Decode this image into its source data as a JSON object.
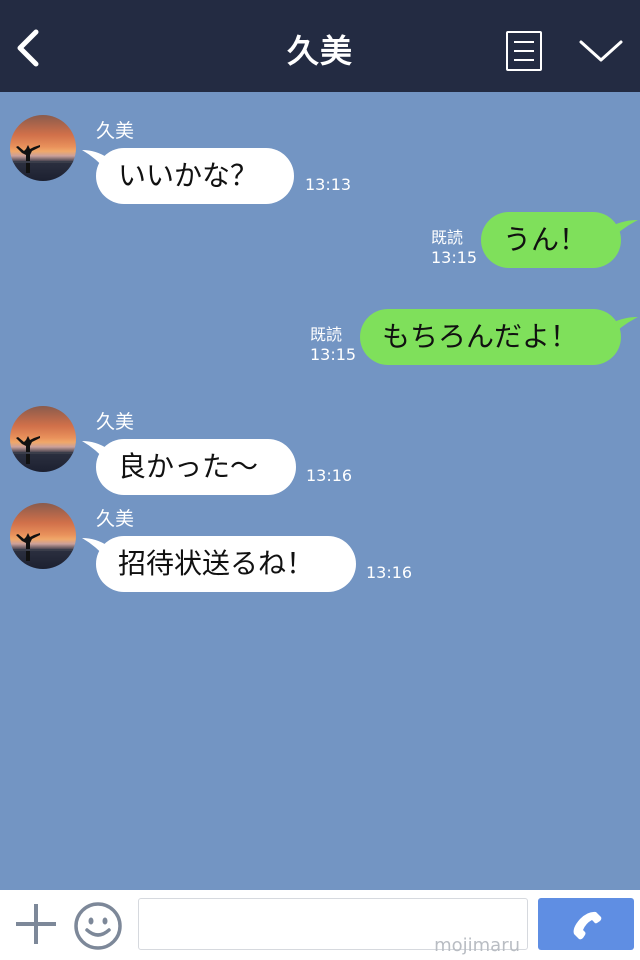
{
  "header": {
    "title": "久美",
    "back_icon": "chevron-left-icon",
    "menu_icon": "menu-icon",
    "collapse_icon": "chevron-down-icon"
  },
  "messages": [
    {
      "direction": "incoming",
      "sender": "久美",
      "text": "いいかな？",
      "time": "13:13"
    },
    {
      "direction": "outgoing",
      "read": "既読",
      "text": "うん！",
      "time": "13:15"
    },
    {
      "direction": "outgoing",
      "read": "既読",
      "text": "もちろんだよ！",
      "time": "13:15"
    },
    {
      "direction": "incoming",
      "sender": "久美",
      "text": "良かった〜",
      "time": "13:16"
    },
    {
      "direction": "incoming",
      "sender": "久美",
      "text": "招待状送るね！",
      "time": "13:16"
    }
  ],
  "footer": {
    "plus_icon": "plus-icon",
    "emoji_icon": "smiley-icon",
    "input_value": "",
    "watermark": "mojimaru",
    "call_icon": "phone-icon"
  },
  "colors": {
    "header_bg": "#232b42",
    "chat_bg": "#7395c3",
    "incoming_bubble": "#ffffff",
    "outgoing_bubble": "#7fe05b",
    "call_button": "#5f8ee3"
  }
}
